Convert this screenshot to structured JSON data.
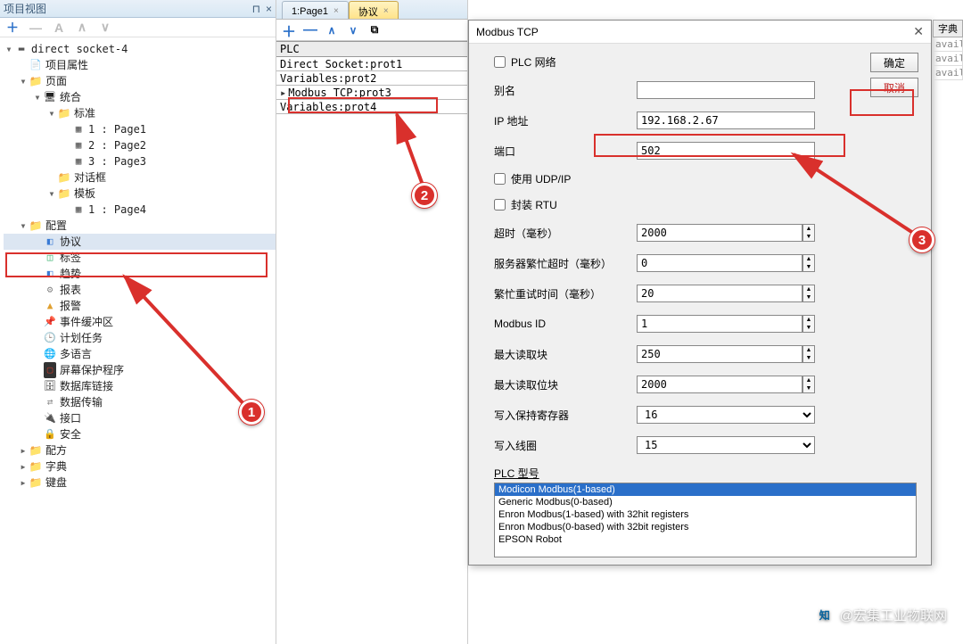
{
  "left": {
    "title": "项目视图",
    "pin": "⊓",
    "close": "×",
    "toolbar": {
      "add": "＋",
      "remove": "—",
      "t3": "A",
      "up": "∧",
      "down": "∨"
    },
    "tree": [
      {
        "lvl": 0,
        "tw": "▾",
        "ic": "minus",
        "label": "direct socket-4",
        "int": true
      },
      {
        "lvl": 1,
        "tw": "",
        "ic": "prop",
        "label": "项目属性",
        "int": true
      },
      {
        "lvl": 1,
        "tw": "▾",
        "ic": "folder",
        "label": "页面",
        "int": true
      },
      {
        "lvl": 2,
        "tw": "▾",
        "ic": "integrate",
        "label": "统合",
        "int": true
      },
      {
        "lvl": 3,
        "tw": "▾",
        "ic": "folder",
        "label": "标准",
        "int": true
      },
      {
        "lvl": 4,
        "tw": "",
        "ic": "page",
        "label": "1 : Page1",
        "int": true
      },
      {
        "lvl": 4,
        "tw": "",
        "ic": "page",
        "label": "2 : Page2",
        "int": true
      },
      {
        "lvl": 4,
        "tw": "",
        "ic": "page",
        "label": "3 : Page3",
        "int": true
      },
      {
        "lvl": 3,
        "tw": "",
        "ic": "folder",
        "label": "对话框",
        "int": true
      },
      {
        "lvl": 3,
        "tw": "▾",
        "ic": "folder",
        "label": "模板",
        "int": true
      },
      {
        "lvl": 4,
        "tw": "",
        "ic": "page",
        "label": "1 : Page4",
        "int": true
      },
      {
        "lvl": 1,
        "tw": "▾",
        "ic": "folder",
        "label": "配置",
        "int": true
      },
      {
        "lvl": 2,
        "tw": "",
        "ic": "blue",
        "label": "协议",
        "int": true,
        "selected": true
      },
      {
        "lvl": 2,
        "tw": "",
        "ic": "green",
        "label": "标签",
        "int": true
      },
      {
        "lvl": 2,
        "tw": "",
        "ic": "blue",
        "label": "趋势",
        "int": true
      },
      {
        "lvl": 2,
        "tw": "",
        "ic": "gear",
        "label": "报表",
        "int": true
      },
      {
        "lvl": 2,
        "tw": "",
        "ic": "yellow",
        "label": "报警",
        "int": true
      },
      {
        "lvl": 2,
        "tw": "",
        "ic": "pin",
        "label": "事件缓冲区",
        "int": true
      },
      {
        "lvl": 2,
        "tw": "",
        "ic": "clock",
        "label": "计划任务",
        "int": true
      },
      {
        "lvl": 2,
        "tw": "",
        "ic": "globe",
        "label": "多语言",
        "int": true
      },
      {
        "lvl": 2,
        "tw": "",
        "ic": "screen",
        "label": "屏幕保护程序",
        "int": true
      },
      {
        "lvl": 2,
        "tw": "",
        "ic": "db",
        "label": "数据库链接",
        "int": true
      },
      {
        "lvl": 2,
        "tw": "",
        "ic": "xfer",
        "label": "数据传输",
        "int": true
      },
      {
        "lvl": 2,
        "tw": "",
        "ic": "plug",
        "label": "接口",
        "int": true
      },
      {
        "lvl": 2,
        "tw": "",
        "ic": "lock",
        "label": "安全",
        "int": true
      },
      {
        "lvl": 1,
        "tw": "▸",
        "ic": "folder",
        "label": "配方",
        "int": true
      },
      {
        "lvl": 1,
        "tw": "▸",
        "ic": "folder",
        "label": "字典",
        "int": true
      },
      {
        "lvl": 1,
        "tw": "▸",
        "ic": "folder",
        "label": "键盘",
        "int": true
      }
    ]
  },
  "mid": {
    "tabs": [
      {
        "label": "1:Page1",
        "active": false
      },
      {
        "label": "协议",
        "active": true
      }
    ],
    "tab_close": "×",
    "toolbar": {
      "add": "＋",
      "remove": "—",
      "up": "∧",
      "down": "∨",
      "icon": "⧉"
    },
    "plc_header": "PLC",
    "plc_rows": [
      {
        "label": "Direct Socket:prot1",
        "sel": false
      },
      {
        "label": "Variables:prot2",
        "sel": false
      },
      {
        "label": "Modbus TCP:prot3",
        "sel": true
      },
      {
        "label": "Variables:prot4",
        "sel": false
      }
    ]
  },
  "dialog": {
    "title": "Modbus TCP",
    "close": "✕",
    "buttons": {
      "ok": "确定",
      "cancel": "取消"
    },
    "check_plcnet": "PLC 网络",
    "alias_label": "别名",
    "alias_value": "",
    "ip_label": "IP 地址",
    "ip_value": "192.168.2.67",
    "port_label": "端口",
    "port_value": "502",
    "check_udp": "使用 UDP/IP",
    "check_rtu": "封装 RTU",
    "timeout_label": "超时（毫秒）",
    "timeout_value": "2000",
    "busy_label": "服务器繁忙超时（毫秒）",
    "busy_value": "0",
    "retry_label": "繁忙重试时间（毫秒）",
    "retry_value": "20",
    "mid_label": "Modbus ID",
    "mid_value": "1",
    "maxread_label": "最大读取块",
    "maxread_value": "250",
    "maxreadbit_label": "最大读取位块",
    "maxreadbit_value": "2000",
    "hold_label": "写入保持寄存器",
    "hold_value": "16",
    "coil_label": "写入线圈",
    "coil_value": "15",
    "plc_model_label": "PLC 型号",
    "plc_model_opts": [
      {
        "label": "Modicon Modbus(1-based)",
        "sel": true
      },
      {
        "label": "Generic Modbus(0-based)",
        "sel": false
      },
      {
        "label": "Enron Modbus(1-based) with 32hit registers",
        "sel": false
      },
      {
        "label": "Enron Modbus(0-based) with 32bit registers",
        "sel": false
      },
      {
        "label": "EPSON Robot",
        "sel": false
      }
    ]
  },
  "right": {
    "header": "字典",
    "cells": [
      "avail",
      "avail",
      "avail"
    ]
  },
  "badges": {
    "b1": "1",
    "b2": "2",
    "b3": "3"
  },
  "watermark": {
    "logo": "知",
    "text": "@宏集工业物联网"
  }
}
